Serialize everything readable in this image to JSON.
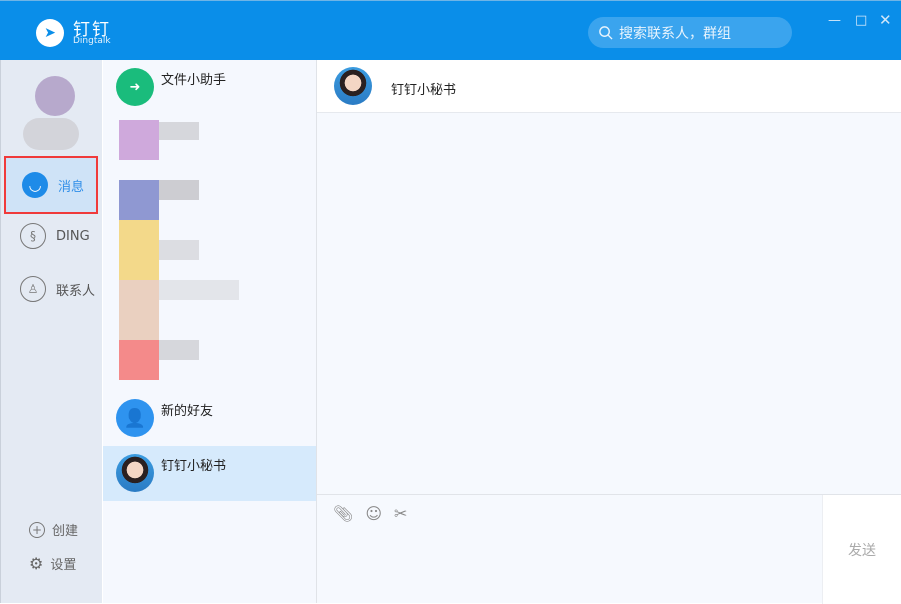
{
  "app": {
    "brand": "钉钉",
    "brand_sub": "Dingtalk",
    "search_placeholder": "搜索联系人，群组"
  },
  "nav": {
    "items": [
      {
        "label": "消息",
        "icon": "smile-chat-icon",
        "active": true
      },
      {
        "label": "DING",
        "icon": "ding-icon"
      },
      {
        "label": "联系人",
        "icon": "contact-icon"
      }
    ],
    "footer": [
      {
        "label": "创建",
        "icon": "plus-circle-icon"
      },
      {
        "label": "设置",
        "icon": "gear-icon"
      }
    ]
  },
  "conversations": [
    {
      "name": "文件小助手",
      "icon": "folder-transfer-icon",
      "color": "#1abc7c"
    },
    {
      "name": "新的好友",
      "icon": "add-user-icon",
      "color": "#2e93ef"
    },
    {
      "name": "钉钉小秘书",
      "icon": "secretary-avatar",
      "selected": true
    }
  ],
  "chat": {
    "title": "钉钉小秘书",
    "send_label": "发送",
    "tools": [
      "paperclip-icon",
      "emoji-icon",
      "scissors-icon"
    ]
  }
}
